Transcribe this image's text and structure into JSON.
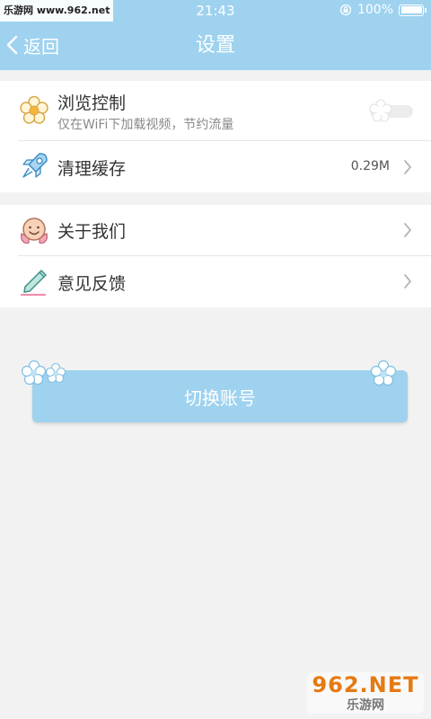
{
  "status_bar": {
    "watermark": "乐游网 www.962.net",
    "time": "21:43",
    "battery": "100%"
  },
  "nav": {
    "back_label": "返回",
    "title": "设置"
  },
  "settings": {
    "browse_control": {
      "title": "浏览控制",
      "subtitle": "仅在WiFi下加载视频，节约流量",
      "toggle_on": false
    },
    "clear_cache": {
      "title": "清理缓存",
      "value": "0.29M"
    },
    "about": {
      "title": "关于我们"
    },
    "feedback": {
      "title": "意见反馈"
    }
  },
  "switch_account": {
    "label": "切换账号"
  },
  "watermark_logo": {
    "main": "962.NET",
    "sub": "乐游网"
  },
  "colors": {
    "header": "#9ed2ef",
    "button": "#9ed2ef",
    "background": "#f2f2f2"
  }
}
